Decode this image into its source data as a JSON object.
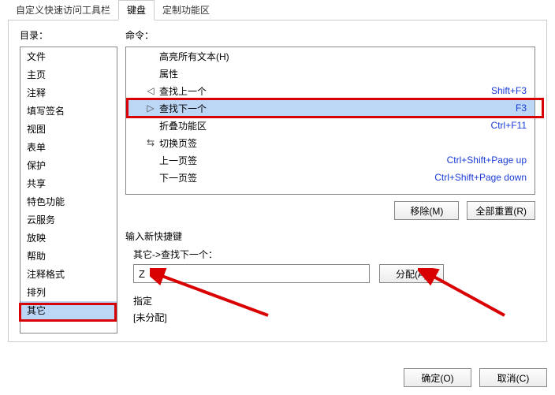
{
  "tabs": {
    "t0": "自定义快速访问工具栏",
    "t1": "键盘",
    "t2": "定制功能区"
  },
  "labels": {
    "catalog": "目录：",
    "command": "命令：",
    "newshortcut": "输入新快捷键",
    "assigned": "指定",
    "unassigned": "[未分配]"
  },
  "categories": {
    "items": [
      "文件",
      "主页",
      "注释",
      "填写签名",
      "视图",
      "表单",
      "保护",
      "共享",
      "特色功能",
      "云服务",
      "放映",
      "帮助",
      "注释格式",
      "排列",
      "其它"
    ],
    "selectedIndex": 14
  },
  "commands": {
    "items": [
      {
        "label": "高亮所有文本(H)",
        "shortcut": "",
        "icon": ""
      },
      {
        "label": "属性",
        "shortcut": "",
        "icon": ""
      },
      {
        "label": "查找上一个",
        "shortcut": "Shift+F3",
        "icon": "◁"
      },
      {
        "label": "查找下一个",
        "shortcut": "F3",
        "icon": "▷",
        "selected": true
      },
      {
        "label": "折叠功能区",
        "shortcut": "Ctrl+F11",
        "icon": ""
      },
      {
        "label": "切换页签",
        "shortcut": "",
        "icon": "⇆"
      },
      {
        "label": "上一页签",
        "shortcut": "Ctrl+Shift+Page up",
        "icon": ""
      },
      {
        "label": "下一页签",
        "shortcut": "Ctrl+Shift+Page down",
        "icon": ""
      }
    ]
  },
  "buttons": {
    "remove": "移除(M)",
    "resetall": "全部重置(R)",
    "assign": "分配(A)",
    "ok": "确定(O)",
    "cancel": "取消(C)"
  },
  "path": "其它->查找下一个：",
  "inputValue": "Z"
}
